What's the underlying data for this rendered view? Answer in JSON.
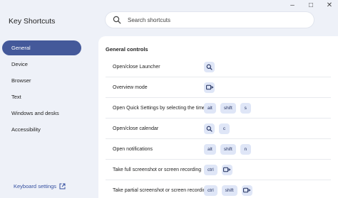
{
  "window": {
    "controls": {
      "minimize": "–",
      "maximize": "□",
      "close": "✕"
    }
  },
  "app": {
    "title": "Key Shortcuts"
  },
  "search": {
    "placeholder": "Search shortcuts",
    "value": ""
  },
  "sidebar": {
    "items": [
      {
        "label": "General",
        "active": true
      },
      {
        "label": "Device"
      },
      {
        "label": "Browser"
      },
      {
        "label": "Text"
      },
      {
        "label": "Windows and desks"
      },
      {
        "label": "Accessibility"
      }
    ],
    "footer_link": "Keyboard settings"
  },
  "main": {
    "section_title": "General controls",
    "rows": [
      {
        "label": "Open/close Launcher",
        "keys": [
          {
            "icon": "search-icon"
          }
        ]
      },
      {
        "label": "Overview mode",
        "keys": [
          {
            "icon": "overview-icon"
          }
        ]
      },
      {
        "label": "Open Quick Settings by selecting the time",
        "keys": [
          {
            "text": "alt"
          },
          {
            "text": "shift"
          },
          {
            "text": "s"
          }
        ]
      },
      {
        "label": "Open/close calendar",
        "keys": [
          {
            "icon": "search-icon"
          },
          {
            "text": "c"
          }
        ]
      },
      {
        "label": "Open notifications",
        "keys": [
          {
            "text": "alt"
          },
          {
            "text": "shift"
          },
          {
            "text": "n"
          }
        ]
      },
      {
        "label": "Take full screenshot or screen recording",
        "keys": [
          {
            "text": "ctrl"
          },
          {
            "icon": "overview-icon"
          }
        ]
      },
      {
        "label": "Take partial screenshot or screen recording",
        "keys": [
          {
            "text": "ctrl"
          },
          {
            "text": "shift"
          },
          {
            "icon": "overview-icon"
          }
        ]
      }
    ]
  },
  "colors": {
    "accent": "#44599a",
    "key_bg": "#dfe6f7",
    "link": "#3550a0",
    "background": "#eef1f8"
  }
}
